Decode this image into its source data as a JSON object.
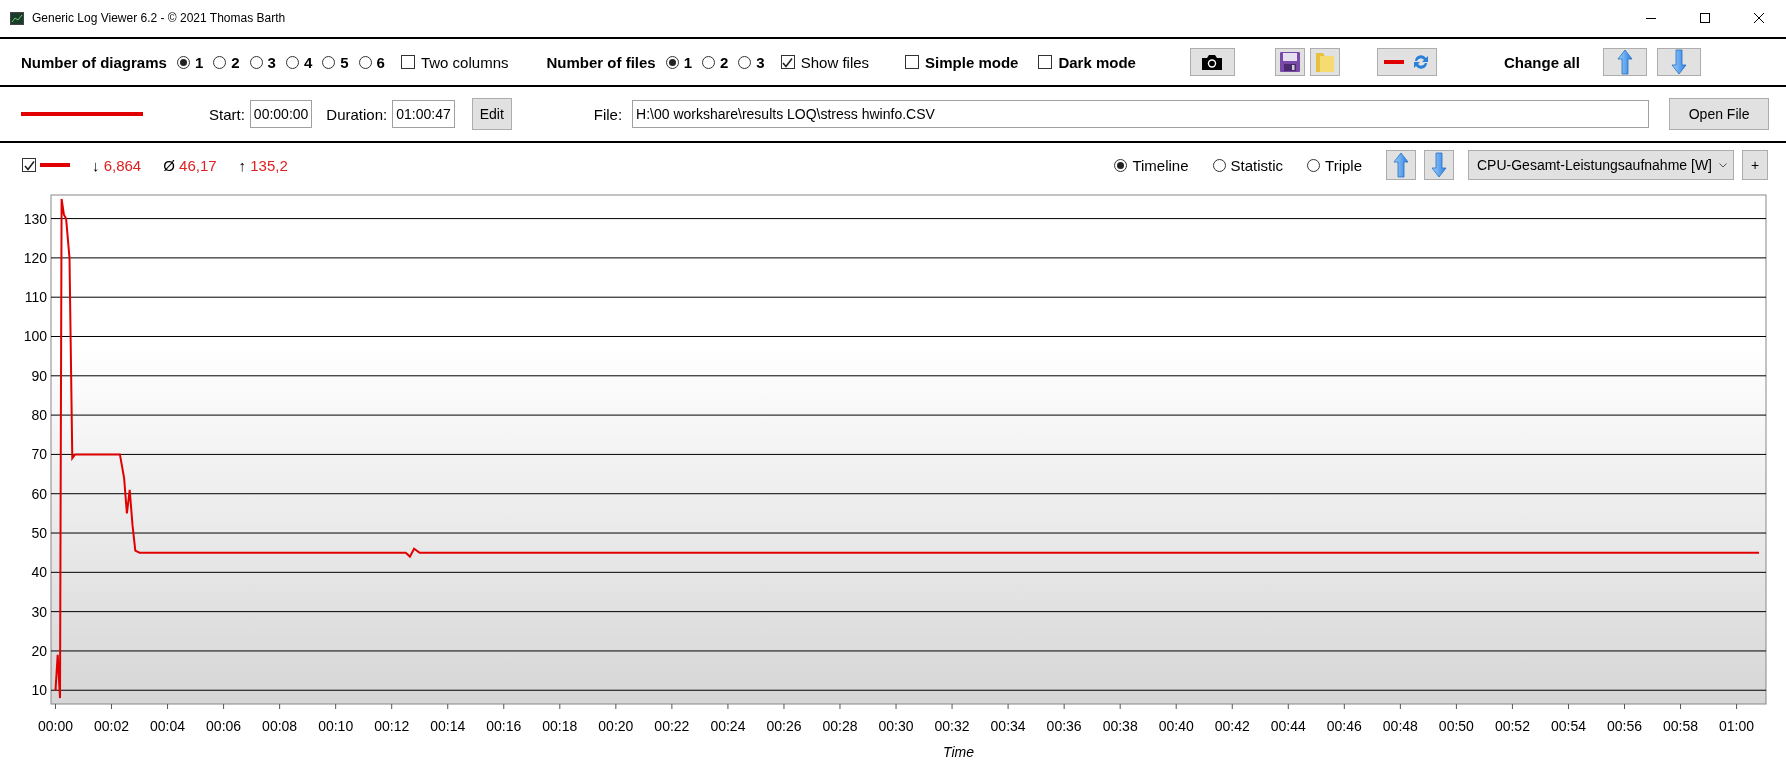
{
  "window": {
    "title": "Generic Log Viewer 6.2 - © 2021 Thomas Barth"
  },
  "toolbar": {
    "diagrams_label": "Number of diagrams",
    "diagram_options": [
      {
        "label": "1",
        "selected": true
      },
      {
        "label": "2",
        "selected": false
      },
      {
        "label": "3",
        "selected": false
      },
      {
        "label": "4",
        "selected": false
      },
      {
        "label": "5",
        "selected": false
      },
      {
        "label": "6",
        "selected": false
      }
    ],
    "two_columns": {
      "label": "Two columns",
      "checked": false
    },
    "files_label": "Number of files",
    "file_options": [
      {
        "label": "1",
        "selected": true
      },
      {
        "label": "2",
        "selected": false
      },
      {
        "label": "3",
        "selected": false
      }
    ],
    "show_files": {
      "label": "Show files",
      "checked": true
    },
    "simple_mode": {
      "label": "Simple mode",
      "checked": false
    },
    "dark_mode": {
      "label": "Dark mode",
      "checked": false
    },
    "change_all_label": "Change all"
  },
  "file_row": {
    "start_label": "Start:",
    "start": "00:00:00",
    "duration_label": "Duration:",
    "duration": "01:00:47",
    "edit_button": "Edit",
    "file_label": "File:",
    "file_path": "H:\\00 workshare\\results LOQ\\stress hwinfo.CSV",
    "open_button": "Open File"
  },
  "diagram": {
    "visible": {
      "checked": true
    },
    "stats": [
      {
        "symbol": "↓",
        "value": "6,864"
      },
      {
        "symbol": "Ø",
        "value": "46,17"
      },
      {
        "symbol": "↑",
        "value": "135,2"
      }
    ],
    "views": [
      {
        "label": "Timeline",
        "selected": true
      },
      {
        "label": "Statistic",
        "selected": false
      },
      {
        "label": "Triple",
        "selected": false
      }
    ],
    "channel": "CPU-Gesamt-Leistungsaufnahme [W]",
    "add_button": "+",
    "chart_data": {
      "type": "line",
      "grid": true,
      "xlabel": "Time",
      "xlim": [
        -0.16,
        61.05
      ],
      "ylim": [
        6.5,
        136
      ],
      "x": [
        0,
        0.08,
        0.16,
        0.22,
        0.3,
        0.38,
        0.5,
        0.6,
        0.7,
        0.8,
        1.2,
        2.0,
        2.3,
        2.45,
        2.55,
        2.65,
        2.75,
        2.85,
        3.0,
        5,
        8,
        12.5,
        12.65,
        12.8,
        13,
        20,
        30,
        40,
        50,
        60.8
      ],
      "series": [
        {
          "color": "#e00000",
          "values": [
            10,
            19,
            8,
            135,
            131,
            130,
            120,
            69,
            70,
            70,
            70,
            70,
            70,
            64,
            55,
            61,
            52,
            45.5,
            45,
            45,
            45,
            45,
            44,
            46,
            45,
            45,
            45,
            45,
            45,
            45
          ]
        }
      ],
      "xticks": [
        {
          "value": 0,
          "label": "00:00"
        },
        {
          "value": 2,
          "label": "00:02"
        },
        {
          "value": 4,
          "label": "00:04"
        },
        {
          "value": 6,
          "label": "00:06"
        },
        {
          "value": 8,
          "label": "00:08"
        },
        {
          "value": 10,
          "label": "00:10"
        },
        {
          "value": 12,
          "label": "00:12"
        },
        {
          "value": 14,
          "label": "00:14"
        },
        {
          "value": 16,
          "label": "00:16"
        },
        {
          "value": 18,
          "label": "00:18"
        },
        {
          "value": 20,
          "label": "00:20"
        },
        {
          "value": 22,
          "label": "00:22"
        },
        {
          "value": 24,
          "label": "00:24"
        },
        {
          "value": 26,
          "label": "00:26"
        },
        {
          "value": 28,
          "label": "00:28"
        },
        {
          "value": 30,
          "label": "00:30"
        },
        {
          "value": 32,
          "label": "00:32"
        },
        {
          "value": 34,
          "label": "00:34"
        },
        {
          "value": 36,
          "label": "00:36"
        },
        {
          "value": 38,
          "label": "00:38"
        },
        {
          "value": 40,
          "label": "00:40"
        },
        {
          "value": 42,
          "label": "00:42"
        },
        {
          "value": 44,
          "label": "00:44"
        },
        {
          "value": 46,
          "label": "00:46"
        },
        {
          "value": 48,
          "label": "00:48"
        },
        {
          "value": 50,
          "label": "00:50"
        },
        {
          "value": 52,
          "label": "00:52"
        },
        {
          "value": 54,
          "label": "00:54"
        },
        {
          "value": 56,
          "label": "00:56"
        },
        {
          "value": 58,
          "label": "00:58"
        },
        {
          "value": 60,
          "label": "01:00"
        }
      ],
      "yticks": [
        10,
        20,
        30,
        40,
        50,
        60,
        70,
        80,
        90,
        100,
        110,
        120,
        130
      ]
    }
  }
}
